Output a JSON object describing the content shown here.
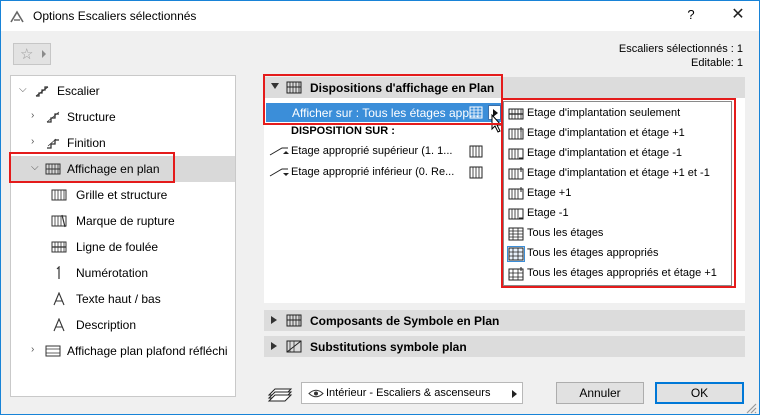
{
  "window": {
    "title": "Options Escaliers sélectionnés",
    "help_label": "?",
    "close_label": "✕"
  },
  "selection_info": {
    "selected": "Escaliers sélectionnés : 1",
    "editable": "Editable: 1"
  },
  "tree": {
    "items": [
      {
        "label": "Escalier",
        "icon": "stair-icon"
      },
      {
        "label": "Structure",
        "icon": "structure-icon"
      },
      {
        "label": "Finition",
        "icon": "finish-icon"
      },
      {
        "label": "Affichage en plan",
        "icon": "floor-plan-display-icon"
      },
      {
        "label": "Grille et structure",
        "icon": "grid-icon"
      },
      {
        "label": "Marque de rupture",
        "icon": "break-mark-icon"
      },
      {
        "label": "Ligne de foulée",
        "icon": "walking-line-icon"
      },
      {
        "label": "Numérotation",
        "icon": "numbering-icon"
      },
      {
        "label": "Texte haut / bas",
        "icon": "up-down-text-icon"
      },
      {
        "label": "Description",
        "icon": "description-icon"
      },
      {
        "label": "Affichage plan plafond réfléchi",
        "icon": "ceiling-plan-icon"
      }
    ]
  },
  "sections": {
    "disp": {
      "title": "Dispositions d'affichage en Plan",
      "expanded": true
    },
    "comp": {
      "title": "Composants de Symbole en Plan",
      "expanded": false
    },
    "subst": {
      "title": "Substitutions symbole plan",
      "expanded": false
    }
  },
  "show_on": {
    "label": "Afficher sur : Tous les étages app..."
  },
  "disposition": {
    "heading": "DISPOSITION SUR :",
    "rows": [
      {
        "label": "Etage approprié supérieur (1. 1..."
      },
      {
        "label": "Etage approprié inférieur (0. Re..."
      }
    ]
  },
  "popup": {
    "items": [
      {
        "label": "Etage d'implantation seulement",
        "highlighted": false
      },
      {
        "label": "Etage d'implantation et étage +1",
        "highlighted": false
      },
      {
        "label": "Etage d'implantation et étage -1",
        "highlighted": false
      },
      {
        "label": "Etage d'implantation et étage +1 et -1",
        "highlighted": false
      },
      {
        "label": "Etage +1",
        "highlighted": false
      },
      {
        "label": "Etage -1",
        "highlighted": false
      },
      {
        "label": "Tous les étages",
        "highlighted": false
      },
      {
        "label": "Tous les étages appropriés",
        "highlighted": true
      },
      {
        "label": "Tous les étages appropriés et étage +1",
        "highlighted": false
      }
    ]
  },
  "footer": {
    "view": "Intérieur - Escaliers & ascenseurs",
    "cancel": "Annuler",
    "ok": "OK"
  },
  "colors": {
    "selection_blue": "#3b8ed9",
    "highlight_red": "#e41b1b",
    "window_border": "#1883d7"
  }
}
